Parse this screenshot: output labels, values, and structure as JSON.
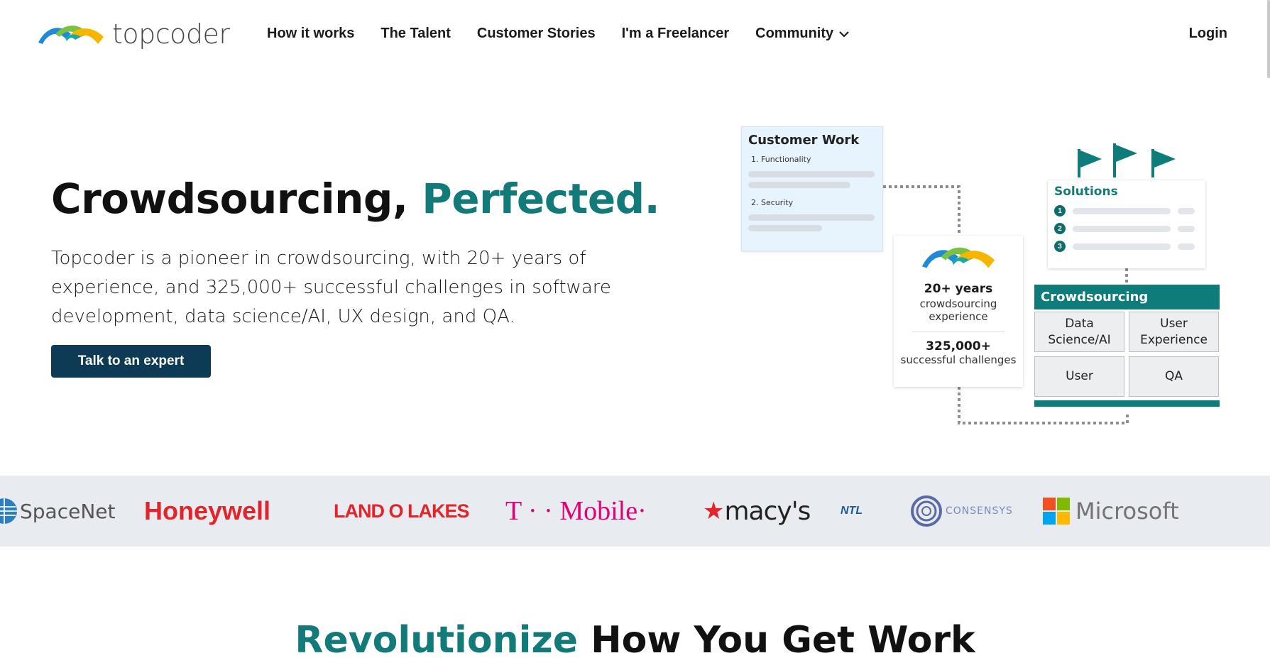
{
  "header": {
    "logo_text": "topcoder",
    "nav": [
      {
        "label": "How it works"
      },
      {
        "label": "The Talent"
      },
      {
        "label": "Customer Stories"
      },
      {
        "label": "I'm a Freelancer"
      },
      {
        "label": "Community",
        "icon": "chevron-down-icon"
      }
    ],
    "login_label": "Login"
  },
  "hero": {
    "title_main": "Crowdsourcing, ",
    "title_accent": "Perfected.",
    "description": "Topcoder is a pioneer in crowdsourcing, with 20+ years of experience, and 325,000+ successful challenges in software development, data science/AI, UX design, and QA.",
    "cta_label": "Talk to an expert"
  },
  "illustration": {
    "customer_work": {
      "title": "Customer Work",
      "items": [
        "1. Functionality",
        "2. Security"
      ]
    },
    "stats": {
      "years_value": "20+ years",
      "years_label": "crowdsourcing experience",
      "challenges_value": "325,000+",
      "challenges_label": "successful challenges"
    },
    "solutions": {
      "title": "Solutions",
      "numbers": [
        "1",
        "2",
        "3"
      ]
    },
    "crowdsourcing": {
      "title": "Crowdsourcing",
      "cells": [
        "Data Science/AI",
        "User Experience",
        "User",
        "QA"
      ]
    }
  },
  "logos": [
    {
      "name": "SpaceNet",
      "color": "#555555"
    },
    {
      "name": "Honeywell",
      "color": "#e2252a"
    },
    {
      "name": "LAND O LAKES",
      "color": "#e2252a"
    },
    {
      "name": "T · · Mobile·",
      "color": "#e20074"
    },
    {
      "name": "macy's",
      "color": "#222222"
    },
    {
      "name": "NTL",
      "color": "#1f5a96"
    },
    {
      "name": "CONSENSYS",
      "color": "#5b6aa3"
    },
    {
      "name": "Microsoft",
      "color": "#737373"
    }
  ],
  "section": {
    "title_accent": "Revolutionize",
    "title_main": " How You Get Work"
  },
  "colors": {
    "accent": "#127a78",
    "cta_bg": "#0d3a55",
    "strip_bg": "#e8ecf0"
  }
}
